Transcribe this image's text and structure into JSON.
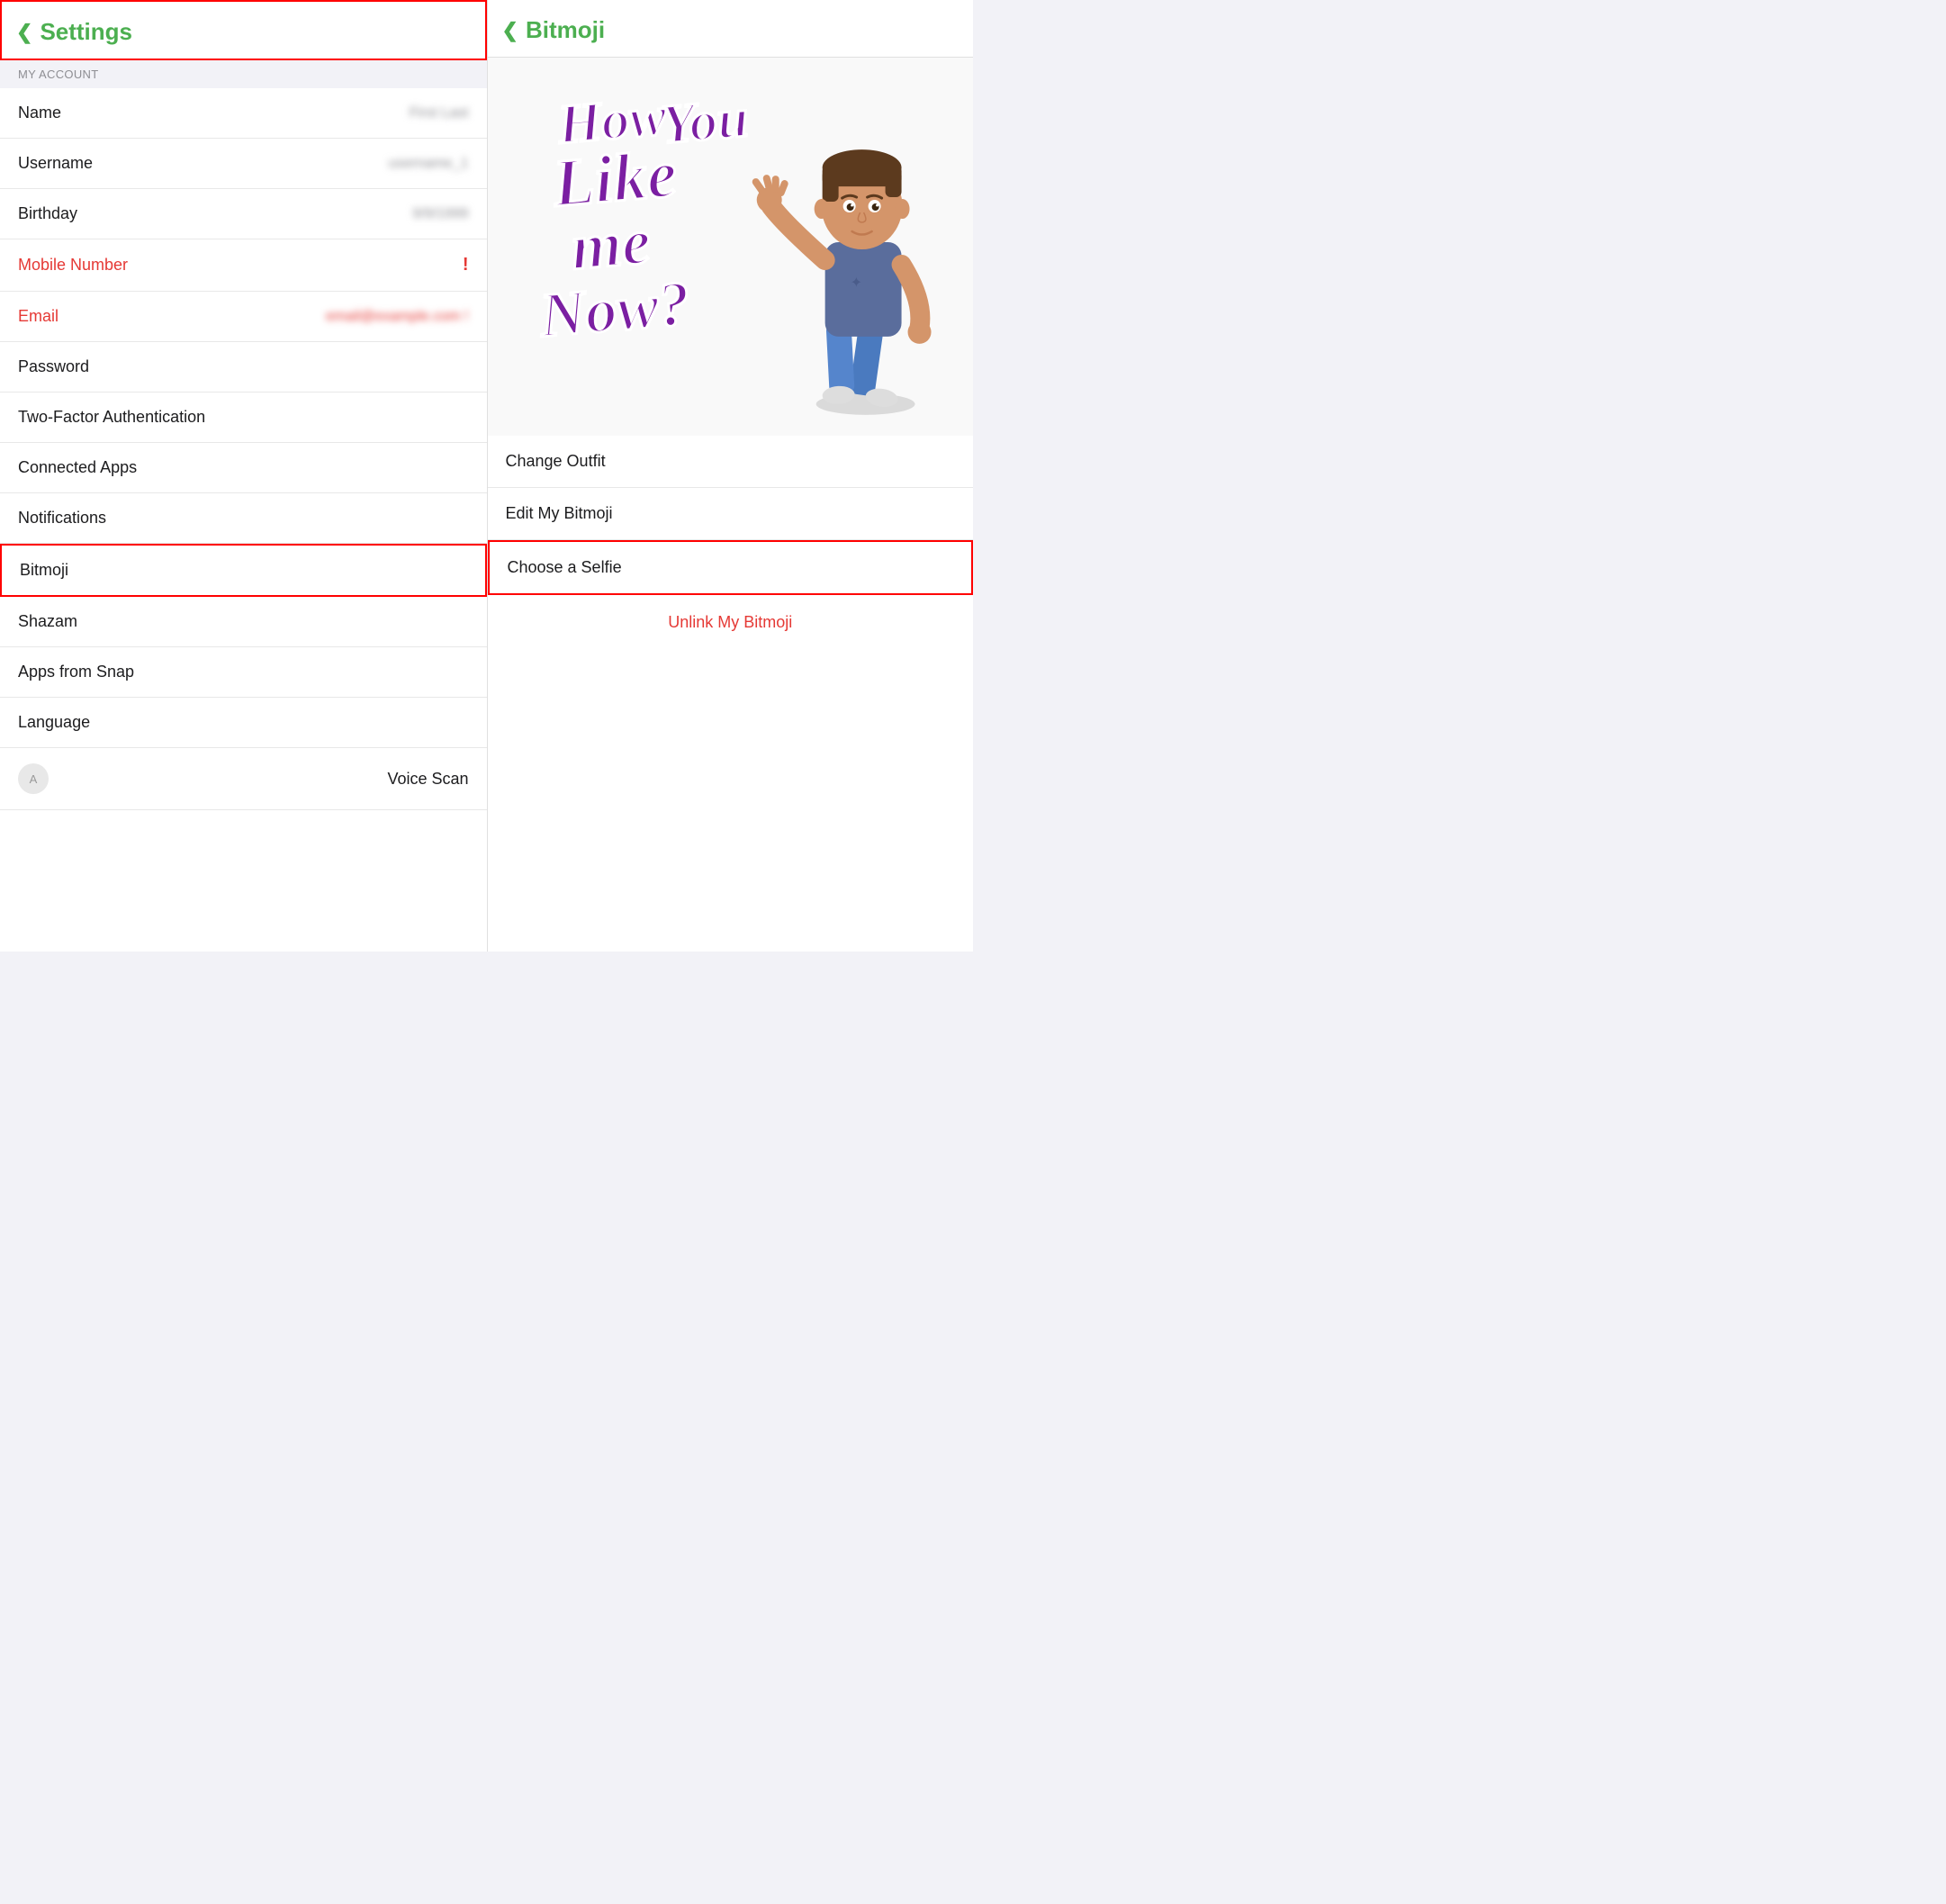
{
  "left": {
    "header": {
      "back_label": "❮",
      "title": "Settings"
    },
    "section_my_account": "MY ACCOUNT",
    "items": [
      {
        "id": "name",
        "label": "Name",
        "value": "First Last",
        "blurred": true,
        "red": false,
        "alert": false
      },
      {
        "id": "username",
        "label": "Username",
        "value": "username_1",
        "blurred": true,
        "red": false,
        "alert": false
      },
      {
        "id": "birthday",
        "label": "Birthday",
        "value": "9/9/1999",
        "blurred": true,
        "red": false,
        "alert": false
      },
      {
        "id": "mobile",
        "label": "Mobile Number",
        "value": "",
        "blurred": false,
        "red": true,
        "alert": true
      },
      {
        "id": "email",
        "label": "Email",
        "value": "email@example.com",
        "blurred": true,
        "red": true,
        "alert": true
      },
      {
        "id": "password",
        "label": "Password",
        "value": "",
        "blurred": false,
        "red": false,
        "alert": false
      },
      {
        "id": "two_factor",
        "label": "Two-Factor Authentication",
        "value": "",
        "blurred": false,
        "red": false,
        "alert": false
      },
      {
        "id": "connected_apps",
        "label": "Connected Apps",
        "value": "",
        "blurred": false,
        "red": false,
        "alert": false
      },
      {
        "id": "notifications",
        "label": "Notifications",
        "value": "",
        "blurred": false,
        "red": false,
        "alert": false
      },
      {
        "id": "bitmoji",
        "label": "Bitmoji",
        "value": "",
        "blurred": false,
        "red": false,
        "alert": false,
        "highlighted": true
      },
      {
        "id": "shazam",
        "label": "Shazam",
        "value": "",
        "blurred": false,
        "red": false,
        "alert": false
      },
      {
        "id": "apps_from_snap",
        "label": "Apps from Snap",
        "value": "",
        "blurred": false,
        "red": false,
        "alert": false
      },
      {
        "id": "language",
        "label": "Language",
        "value": "",
        "blurred": false,
        "red": false,
        "alert": false
      },
      {
        "id": "voice_scan",
        "label": "Voice Scan",
        "value": "",
        "blurred": false,
        "red": false,
        "alert": false
      }
    ]
  },
  "right": {
    "header": {
      "back_label": "❮",
      "title": "Bitmoji"
    },
    "options": [
      {
        "id": "change_outfit",
        "label": "Change Outfit",
        "highlighted": false
      },
      {
        "id": "edit_bitmoji",
        "label": "Edit My Bitmoji",
        "highlighted": false
      },
      {
        "id": "choose_selfie",
        "label": "Choose a Selfie",
        "highlighted": true
      }
    ],
    "unlink_label": "Unlink My Bitmoji"
  },
  "bitmoji_text": "How You Like me Now?",
  "colors": {
    "green": "#4CAF50",
    "red": "#e53935",
    "purple": "#7B1FA2"
  }
}
